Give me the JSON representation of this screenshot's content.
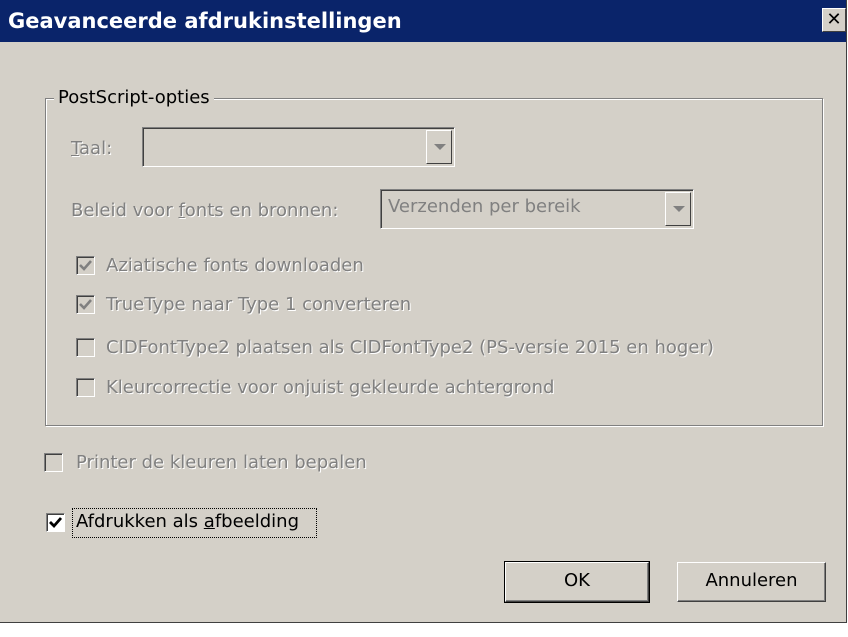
{
  "window": {
    "title": "Geavanceerde afdrukinstellingen",
    "close_glyph": "✕"
  },
  "postscript": {
    "group_title": "PostScript-opties",
    "language": {
      "label_mnemonic": "T",
      "label_rest": "aal:",
      "value": ""
    },
    "font_policy": {
      "label_before": "Beleid voor ",
      "label_mnemonic": "f",
      "label_after": "onts en bronnen:",
      "value": "Verzenden per bereik"
    },
    "options": [
      {
        "label": "Aziatische fonts downloaden",
        "checked": true,
        "enabled": false
      },
      {
        "label": "TrueType naar Type 1 converteren",
        "checked": true,
        "enabled": false
      },
      {
        "label": "CIDFontType2 plaatsen als CIDFontType2 (PS-versie 2015 en hoger)",
        "checked": false,
        "enabled": false
      },
      {
        "label": "Kleurcorrectie voor onjuist gekleurde achtergrond",
        "checked": false,
        "enabled": false
      }
    ]
  },
  "printer_colors": {
    "label": "Printer de kleuren laten bepalen",
    "checked": false,
    "enabled": false
  },
  "print_as_image": {
    "label_before": "Afdrukken als ",
    "label_mnemonic": "a",
    "label_after": "fbeelding",
    "checked": true,
    "enabled": true
  },
  "buttons": {
    "ok": "OK",
    "cancel": "Annuleren"
  }
}
